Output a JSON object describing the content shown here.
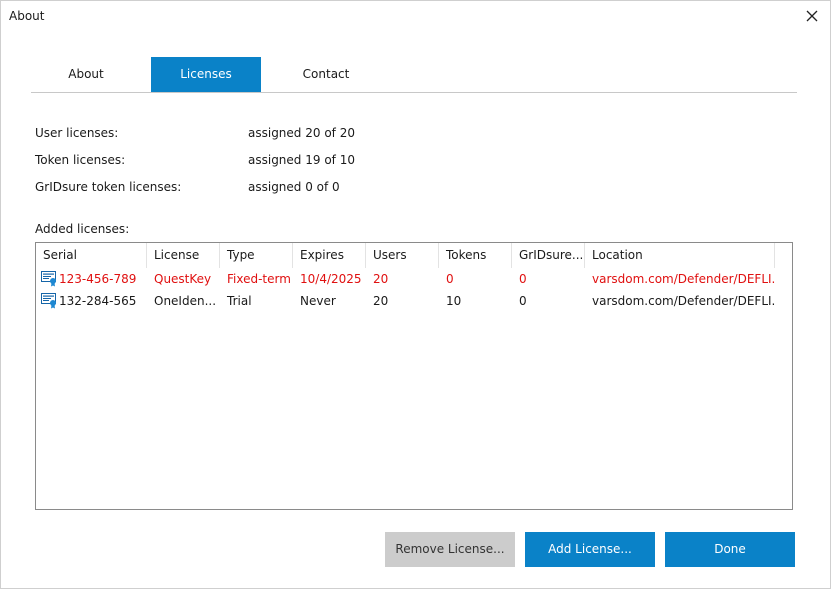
{
  "window": {
    "title": "About"
  },
  "tabs": [
    {
      "label": "About"
    },
    {
      "label": "Licenses"
    },
    {
      "label": "Contact"
    }
  ],
  "summary": [
    {
      "label": "User licenses:",
      "value": "assigned 20 of 20"
    },
    {
      "label": "Token licenses:",
      "value": "assigned 19 of 10"
    },
    {
      "label": "GrIDsure token licenses:",
      "value": "assigned 0 of 0"
    }
  ],
  "added_label": "Added licenses:",
  "table": {
    "columns": [
      "Serial",
      "License",
      "Type",
      "Expires",
      "Users",
      "Tokens",
      "GrIDsure...",
      "Location"
    ],
    "rows": [
      {
        "serial": "123-456-789",
        "license": "QuestKey",
        "type": "Fixed-term",
        "expires": "10/4/2025",
        "users": "20",
        "tokens": "0",
        "gridsure": "0",
        "location": "varsdom.com/Defender/DEFLI...",
        "status_color": "#e01010"
      },
      {
        "serial": "132-284-565",
        "license": "OneIden...",
        "type": "Trial",
        "expires": "Never",
        "users": "20",
        "tokens": "10",
        "gridsure": "0",
        "location": "varsdom.com/Defender/DEFLI...",
        "status_color": "#1a1a1a"
      }
    ]
  },
  "buttons": {
    "remove": "Remove License...",
    "add": "Add License...",
    "done": "Done"
  },
  "colors": {
    "accent": "#0a82c8",
    "error": "#e01010",
    "disabled": "#cccccc"
  },
  "icons": {
    "close": "close-icon",
    "license": "certificate-icon"
  }
}
